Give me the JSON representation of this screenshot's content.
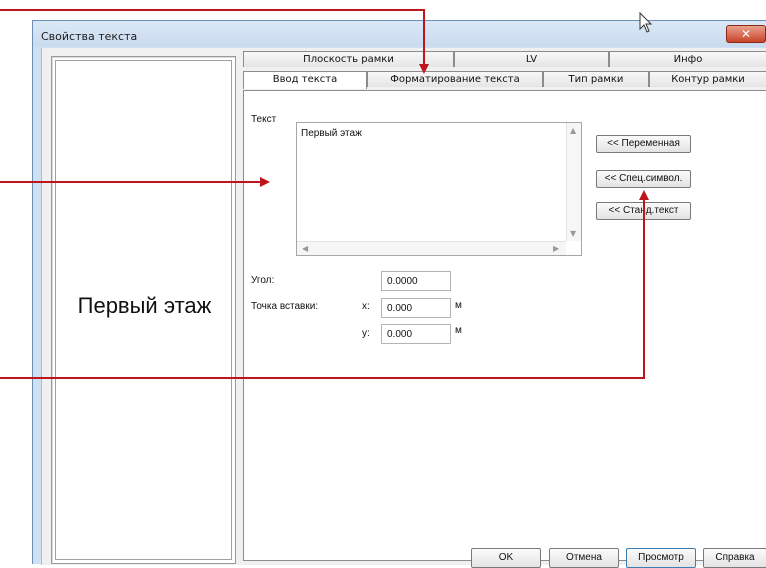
{
  "window": {
    "title": "Свойства текста",
    "close_glyph": "✕"
  },
  "preview": {
    "text": "Первый этаж"
  },
  "tabs_row_back": [
    "Плоскость рамки",
    "LV",
    "Инфо"
  ],
  "tabs_row_front": [
    "Ввод текста",
    "Форматирование текста",
    "Тип рамки",
    "Контур рамки"
  ],
  "text_entry": {
    "label": "Текст",
    "value": "Первый этаж",
    "buttons": [
      "<< Переменная",
      "<< Спец.символ.",
      "<< Станд.текст"
    ]
  },
  "angle": {
    "label": "Угол:",
    "value": "0.0000"
  },
  "insert_point": {
    "label": "Точка вставки:",
    "x_label": "x:",
    "x_value": "0.000",
    "x_unit": "м",
    "y_label": "y:",
    "y_value": "0.000",
    "y_unit": "м"
  },
  "footer_buttons": {
    "ok": "OK",
    "cancel": "Отмена",
    "preview": "Просмотр",
    "help": "Справка"
  },
  "colors": {
    "callout": "#c0141c",
    "window_frame": "#cfe0f2"
  },
  "icons": {
    "scroll_up": "▲",
    "scroll_down": "▼",
    "scroll_left": "◀",
    "scroll_right": "▶",
    "cursor": "mouse-pointer-icon"
  }
}
